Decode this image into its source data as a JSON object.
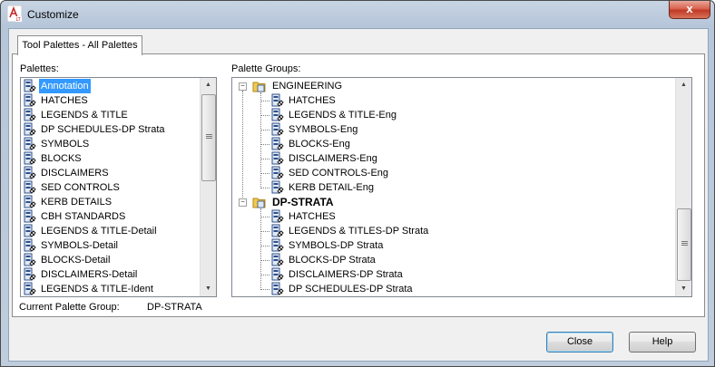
{
  "window": {
    "title": "Customize",
    "close_glyph": "x"
  },
  "tabs": [
    {
      "label": "Tool Palettes - All Palettes"
    }
  ],
  "palettes": {
    "label": "Palettes:",
    "selected_index": 0,
    "items": [
      "Annotation",
      "HATCHES",
      "LEGENDS & TITLE",
      "DP SCHEDULES-DP Strata",
      "SYMBOLS",
      "BLOCKS",
      "DISCLAIMERS",
      "SED CONTROLS",
      "KERB DETAILS",
      "CBH STANDARDS",
      "LEGENDS & TITLE-Detail",
      "SYMBOLS-Detail",
      "BLOCKS-Detail",
      "DISCLAIMERS-Detail",
      "LEGENDS & TITLE-Ident"
    ]
  },
  "palette_groups": {
    "label": "Palette Groups:",
    "groups": [
      {
        "name": "ENGINEERING",
        "bold": false,
        "children": [
          "HATCHES",
          "LEGENDS & TITLE-Eng",
          "SYMBOLS-Eng",
          "BLOCKS-Eng",
          "DISCLAIMERS-Eng",
          "SED CONTROLS-Eng",
          "KERB DETAIL-Eng"
        ]
      },
      {
        "name": "DP-STRATA",
        "bold": true,
        "children": [
          "HATCHES",
          "LEGENDS & TITLES-DP Strata",
          "SYMBOLS-DP Strata",
          "BLOCKS-DP Strata",
          "DISCLAIMERS-DP Strata",
          "DP SCHEDULES-DP Strata"
        ]
      }
    ]
  },
  "current_group": {
    "label": "Current Palette Group:",
    "value": "DP-STRATA"
  },
  "buttons": {
    "close": "Close",
    "help": "Help"
  },
  "icons": {
    "app": "autocad-lt-icon",
    "palette": "tool-palette-icon",
    "group": "folder-icon",
    "collapse": "−"
  },
  "colors": {
    "selection": "#3399ff",
    "title_bar": "#bfcddd",
    "close_button": "#c03a24"
  }
}
